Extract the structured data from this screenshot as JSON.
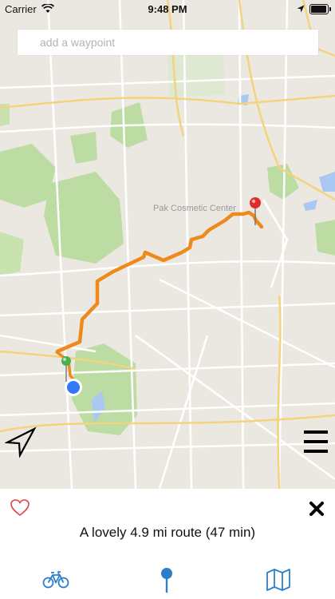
{
  "status_bar": {
    "carrier": "Carrier",
    "time": "9:48 PM"
  },
  "search": {
    "placeholder": "add a waypoint"
  },
  "map": {
    "route_color": "#f0891c",
    "start_marker_color": "#4caf50",
    "end_marker_color": "#e02b2b",
    "current_location_color": "#3478f6",
    "place_labels": [
      "Pak Cosmetic Center"
    ]
  },
  "route": {
    "summary": "A lovely 4.9 mi route (47 min)"
  },
  "icons": {
    "locate": "location-arrow-icon",
    "menu": "hamburger-menu-icon",
    "favorite": "heart-icon",
    "close": "close-icon",
    "bike": "bicycle-icon",
    "pin": "pin-icon",
    "map": "map-icon"
  },
  "colors": {
    "accent": "#2e7fc9",
    "heart": "#e04444"
  }
}
